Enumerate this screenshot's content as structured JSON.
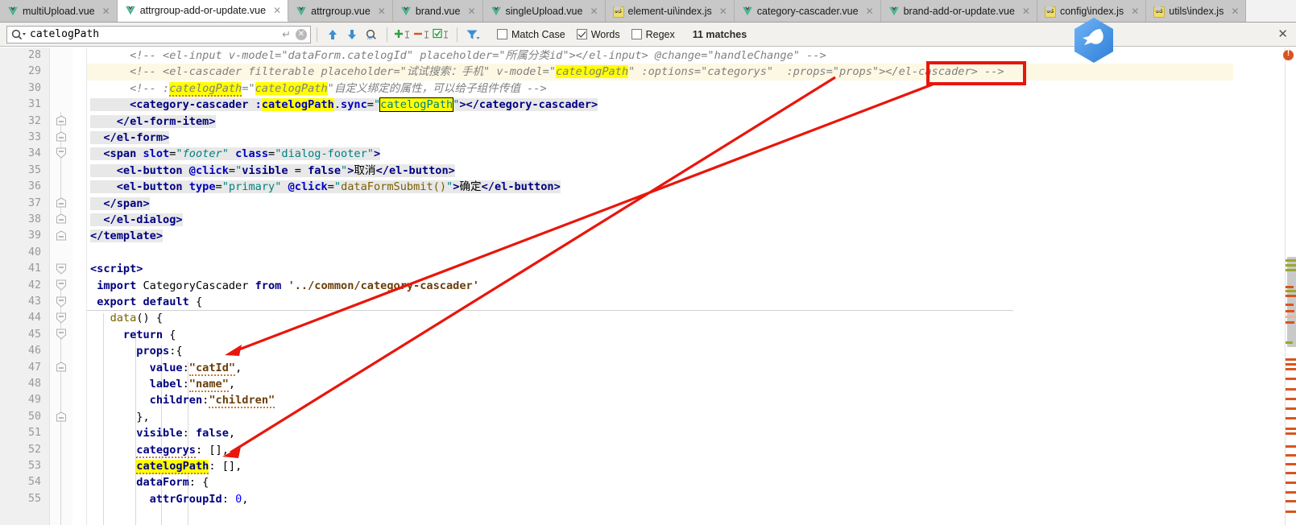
{
  "window": {
    "app": "ide-editor",
    "accent_red": "#e8160c",
    "highlight_yellow": "#ffff00",
    "current_line_bg": "#fdf8e3"
  },
  "tabs": [
    {
      "label": "multiUpload.vue",
      "icon": "vue-icon",
      "active": false,
      "close": "✕"
    },
    {
      "label": "attrgroup-add-or-update.vue",
      "icon": "vue-icon",
      "active": true,
      "close": "✕"
    },
    {
      "label": "attrgroup.vue",
      "icon": "vue-icon",
      "active": false,
      "close": "✕"
    },
    {
      "label": "brand.vue",
      "icon": "vue-icon",
      "active": false,
      "close": "✕"
    },
    {
      "label": "singleUpload.vue",
      "icon": "vue-icon",
      "active": false,
      "close": "✕"
    },
    {
      "label": "element-ui\\index.js",
      "icon": "js-icon",
      "active": false,
      "close": "✕"
    },
    {
      "label": "category-cascader.vue",
      "icon": "vue-icon",
      "active": false,
      "close": "✕"
    },
    {
      "label": "brand-add-or-update.vue",
      "icon": "vue-icon",
      "active": false,
      "close": "✕"
    },
    {
      "label": "config\\index.js",
      "icon": "js-icon",
      "active": false,
      "close": "✕"
    },
    {
      "label": "utils\\index.js",
      "icon": "js-icon",
      "active": false,
      "close": "✕"
    }
  ],
  "findbar": {
    "search_value": "catelogPath",
    "search_placeholder": "Search",
    "enter_glyph": "↵",
    "clear_glyph": "✕",
    "buttons": [
      {
        "name": "find-previous-button",
        "glyph": "↑"
      },
      {
        "name": "find-next-button",
        "glyph": "↓"
      },
      {
        "name": "find-all-button",
        "glyph": "⌕"
      },
      {
        "name": "add-selection-button",
        "glyph": "+"
      },
      {
        "name": "remove-selection-button",
        "glyph": "−"
      },
      {
        "name": "select-all-occurrences-button",
        "glyph": "☑"
      },
      {
        "name": "filter-button",
        "glyph": "∇"
      }
    ],
    "checkboxes": [
      {
        "label": "Match Case",
        "checked": false
      },
      {
        "label": "Words",
        "checked": true
      },
      {
        "label": "Regex",
        "checked": false
      }
    ],
    "matches_text": "11 matches",
    "close_glyph": "✕"
  },
  "editor": {
    "first_line": 28,
    "current_line": 29,
    "line_numbers": [
      28,
      29,
      30,
      31,
      32,
      33,
      34,
      35,
      36,
      37,
      38,
      39,
      40,
      41,
      42,
      43,
      44,
      45,
      46,
      47,
      48,
      49,
      50,
      51,
      52,
      53,
      54,
      55
    ],
    "lines": [
      {
        "n": 28,
        "text": "      <!-- <el-input v-model=\"dataForm.catelogId\" placeholder=\"所属分类id\"></el-input> @change=\"handleChange\" -->"
      },
      {
        "n": 29,
        "text": "      <!-- <el-cascader filterable placeholder=\"试试搜索：手机\" v-model=\"catelogPath\" :options=\"categorys\"  :props=\"props\"></el-cascader> -->"
      },
      {
        "n": 30,
        "text": "      <!-- :catelogPath=\"catelogPath\"自定义绑定的属性，可以给子组件传值 -->"
      },
      {
        "n": 31,
        "text": "      <category-cascader :catelogPath.sync=\"catelogPath\"></category-cascader>"
      },
      {
        "n": 32,
        "text": "    </el-form-item>"
      },
      {
        "n": 33,
        "text": "  </el-form>"
      },
      {
        "n": 34,
        "text": "  <span slot=\"footer\" class=\"dialog-footer\">"
      },
      {
        "n": 35,
        "text": "    <el-button @click=\"visible = false\">取消</el-button>"
      },
      {
        "n": 36,
        "text": "    <el-button type=\"primary\" @click=\"dataFormSubmit()\">确定</el-button>"
      },
      {
        "n": 37,
        "text": "  </span>"
      },
      {
        "n": 38,
        "text": "  </el-dialog>"
      },
      {
        "n": 39,
        "text": "</template>"
      },
      {
        "n": 40,
        "text": ""
      },
      {
        "n": 41,
        "text": "<script>"
      },
      {
        "n": 42,
        "text": " import CategoryCascader from '../common/category-cascader'"
      },
      {
        "n": 43,
        "text": " export default {"
      },
      {
        "n": 44,
        "text": "   data() {"
      },
      {
        "n": 45,
        "text": "     return {"
      },
      {
        "n": 46,
        "text": "       props:{"
      },
      {
        "n": 47,
        "text": "         value:\"catId\","
      },
      {
        "n": 48,
        "text": "         label:\"name\","
      },
      {
        "n": 49,
        "text": "         children:\"children\""
      },
      {
        "n": 50,
        "text": "       },"
      },
      {
        "n": 51,
        "text": "       visible: false,"
      },
      {
        "n": 52,
        "text": "       categorys: [],"
      },
      {
        "n": 53,
        "text": "       catelogPath: [],"
      },
      {
        "n": 54,
        "text": "       dataForm: {"
      },
      {
        "n": 55,
        "text": "         attrGroupId: 0,"
      }
    ],
    "search_term_highlight": "catelogPath",
    "annotations": {
      "red_box_text": ":props=\"props\"",
      "arrow_1": "from :props=\"props\" to props:{",
      "arrow_2": "from :options=\"categorys\" to categorys: []"
    }
  }
}
